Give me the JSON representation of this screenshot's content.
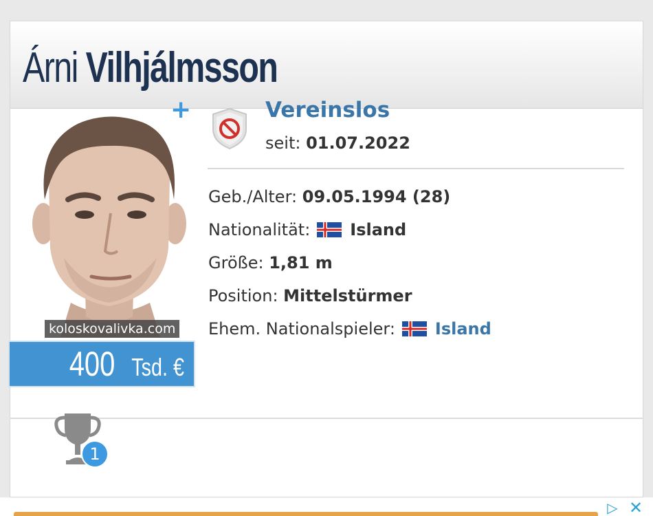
{
  "player": {
    "first_name": "Árni",
    "last_name": "Vilhjálmsson",
    "photo_watermark": "koloskovalivka.com",
    "market_value_number": "400",
    "market_value_unit": "Tsd. €"
  },
  "club": {
    "name": "Vereinslos",
    "since_label": "seit:",
    "since_date": "01.07.2022",
    "icon": "no-club-shield-icon"
  },
  "info": {
    "birth_label": "Geb./Alter:",
    "birth_value": "09.05.1994 (28)",
    "nationality_label": "Nationalität:",
    "nationality_value": "Island",
    "height_label": "Größe:",
    "height_value": "1,81 m",
    "position_label": "Position:",
    "position_value": "Mittelstürmer",
    "former_national_label": "Ehem. Nationalspieler:",
    "former_national_value": "Island"
  },
  "trophies": {
    "count": "1",
    "icon": "trophy-icon"
  },
  "icons": {
    "add": "+",
    "ad_info": "▷",
    "ad_close": "✕"
  },
  "colors": {
    "name_dark": "#1d3150",
    "link_blue": "#3a76a8",
    "market_value_bg": "#4193d2",
    "accent_blue": "#3d9ae0",
    "ad_stripe": "#e6a44a"
  }
}
